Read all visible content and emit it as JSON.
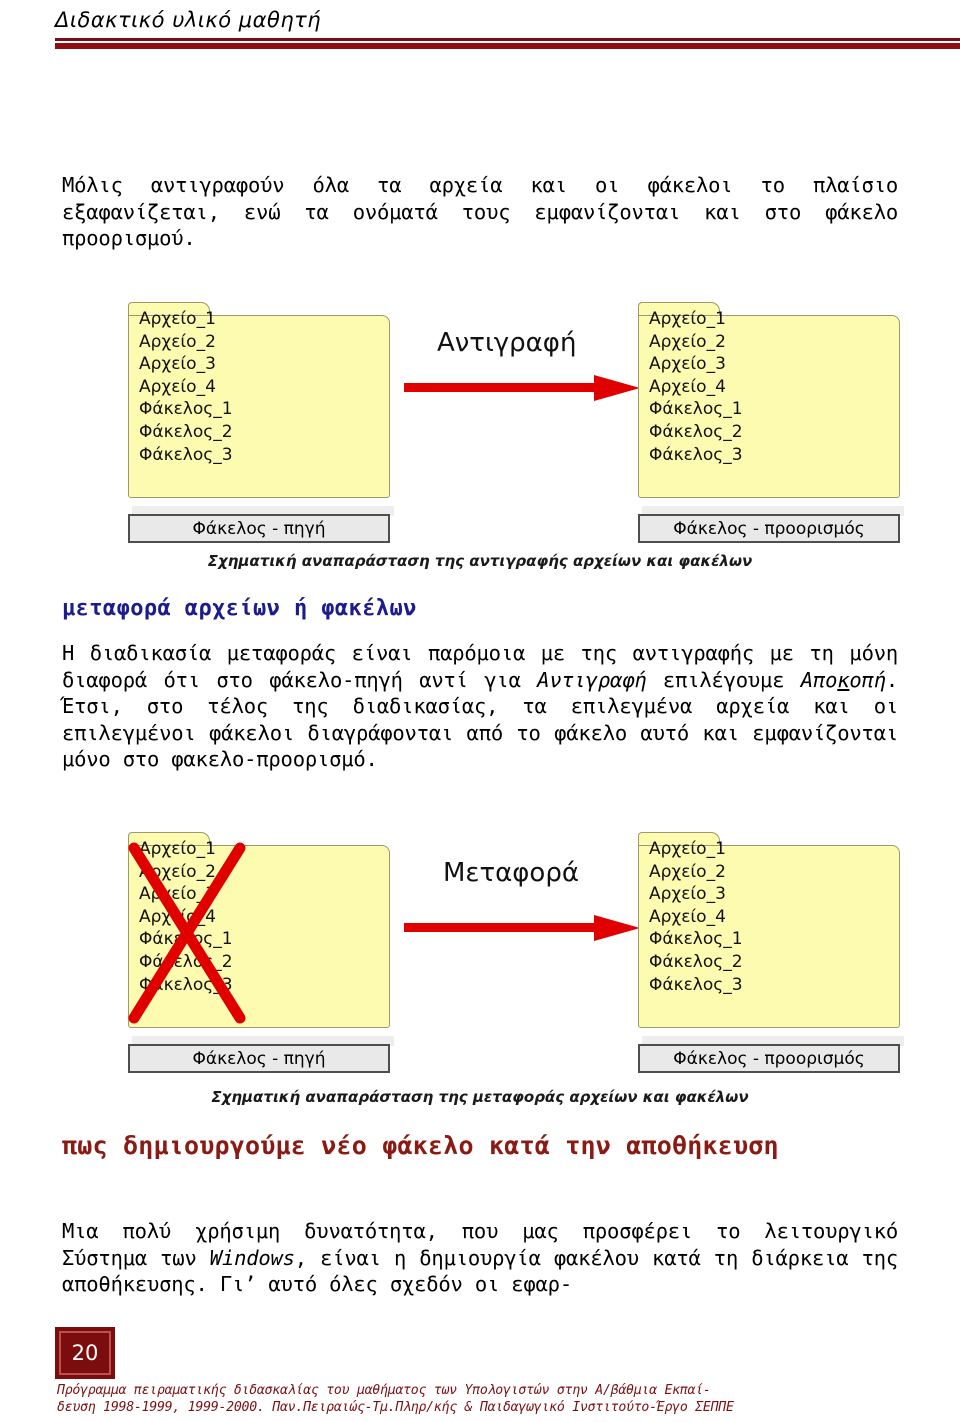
{
  "header": {
    "title": "Διδακτικό υλικό μαθητή"
  },
  "colors": {
    "rule_red": "#8a1011",
    "heading_blue": "#1c1c8f",
    "heading_red": "#8a1a14",
    "folder_yellow": "#fdfbb0",
    "arrow_red": "#e00000",
    "footer_red": "#7b1113"
  },
  "paragraphs": {
    "intro_part1": "Μόλις αντιγραφούν όλα τα αρχεία και οι φάκελοι το πλαίσιο εξαφανίζεται, ενώ τα ονόματά τους εμφανίζονται και στο φάκελο προορισμού.",
    "move_part1": "Η διαδικασία μεταφοράς είναι παρόμοια με της αντιγραφής με τη μόνη διαφορά ότι στο φάκελο-πηγή αντί για ",
    "move_italic1": "Αντιγραφή",
    "move_part2": " επιλέγουμε ",
    "move_italic2_a": "Απο",
    "move_italic2_b": "κ",
    "move_italic2_c": "οπή",
    "move_part3": ". Έτσι, στο τέλος της διαδικασίας, τα επιλεγμένα αρχεία και οι επιλεγμένοι φάκελοι διαγράφονται από το φάκελο αυτό και εμφανίζονται μόνο στο φακελο-προορισμό.",
    "save_part1": "Μια πολύ χρήσιμη δυνατότητα, που μας προσφέρει το λειτουργικό Σύστημα των ",
    "save_italic": "Windows",
    "save_part2": ", είναι η δημιουργία φακέλου κατά τη διάρκεια της αποθήκευσης. Γι’ αυτό όλες σχεδόν οι εφαρ-"
  },
  "headings": {
    "move": "μεταφορά αρχείων ή φακέλων",
    "save": "πως δημιουργούμε νέο φάκελο κατά την αποθήκευση"
  },
  "diagram_copy": {
    "source_items": [
      "Αρχείο_1",
      "Αρχείο_2",
      "Αρχείο_3",
      "Αρχείο_4",
      "Φάκελος_1",
      "Φάκελος_2",
      "Φάκελος_3"
    ],
    "dest_items": [
      "Αρχείο_1",
      "Αρχείο_2",
      "Αρχείο_3",
      "Αρχείο_4",
      "Φάκελος_1",
      "Φάκελος_2",
      "Φάκελος_3"
    ],
    "source_label": "Φάκελος - πηγή",
    "dest_label": "Φάκελος - προορισμός",
    "arrow_label": "Αντιγραφή",
    "caption": "Σχηματική αναπαράσταση της αντιγραφής αρχείων και φακέλων"
  },
  "diagram_move": {
    "source_items": [
      "Αρχείο_1",
      "Αρχείο_2",
      "Αρχείο_3",
      "Αρχείο_4",
      "Φάκελος_1",
      "Φάκελος_2",
      "Φάκελος_3"
    ],
    "dest_items": [
      "Αρχείο_1",
      "Αρχείο_2",
      "Αρχείο_3",
      "Αρχείο_4",
      "Φάκελος_1",
      "Φάκελος_2",
      "Φάκελος_3"
    ],
    "source_label": "Φάκελος - πηγή",
    "dest_label": "Φάκελος - προορισμός",
    "arrow_label": "Μεταφορά",
    "source_crossed_out": true,
    "caption": "Σχηματική αναπαράσταση της μεταφοράς αρχείων και φακέλων"
  },
  "footer": {
    "page_number": "20",
    "line1": "Πρόγραμμα πειραματικής διδασκαλίας του μαθήματος των Υπολογιστών στην  Α/βάθμια Εκπαί-",
    "line2": "δευση 1998-1999, 1999-2000. Παν.Πειραιώς-Τμ.Πληρ/κής & Παιδαγωγικό Ινστιτούτο-Έργο ΣΕΠΠΕ"
  }
}
